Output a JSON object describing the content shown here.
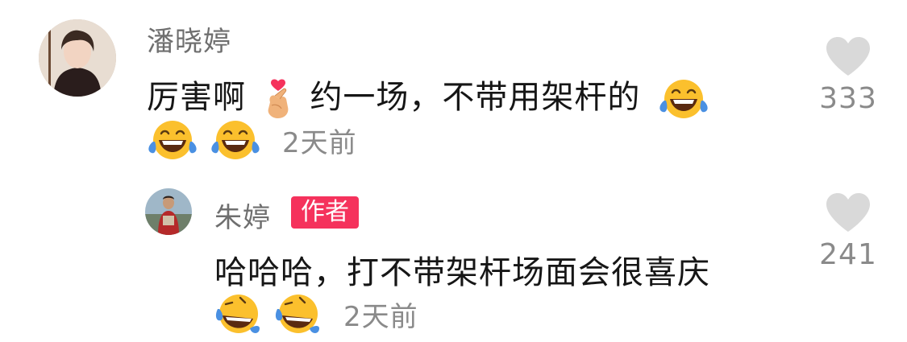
{
  "comments": [
    {
      "username": "潘晓婷",
      "text_part1": "厉害啊",
      "text_part2": "约一场，不带用架杆的",
      "time": "2天前",
      "likes": "333",
      "emojis": [
        "finger-heart-emoji",
        "laughing-tears-emoji",
        "laughing-tears-emoji",
        "laughing-tears-emoji"
      ]
    },
    {
      "username": "朱婷",
      "badge": "作者",
      "text": "哈哈哈，打不带架杆场面会很喜庆",
      "time": "2天前",
      "likes": "241",
      "emojis": [
        "rolling-laughing-emoji",
        "rolling-laughing-emoji"
      ]
    }
  ],
  "colors": {
    "username": "#6f6f6f",
    "text": "#161616",
    "muted": "#8a8a8a",
    "badge": "#f5325c",
    "heart": "#d9d9d9"
  }
}
